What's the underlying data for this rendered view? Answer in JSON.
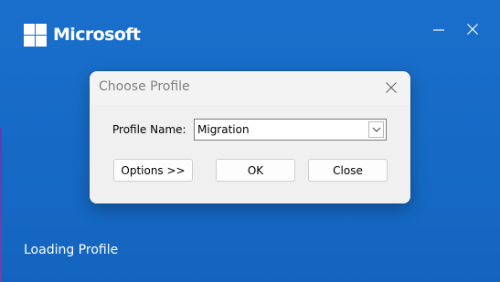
{
  "splash": {
    "brand_name": "Microsoft",
    "status_text": "Loading Profile",
    "logo_icon": "windows-logo-icon",
    "minimize_icon": "minimize-icon",
    "close_icon": "close-icon",
    "background_color": "#1a6fcc"
  },
  "dialog": {
    "title": "Choose Profile",
    "close_icon": "close-icon",
    "profile_label": "Profile Name:",
    "profile_value": "Migration",
    "dropdown_icon": "chevron-down-icon",
    "buttons": {
      "options": "Options >>",
      "ok": "OK",
      "close": "Close"
    }
  }
}
